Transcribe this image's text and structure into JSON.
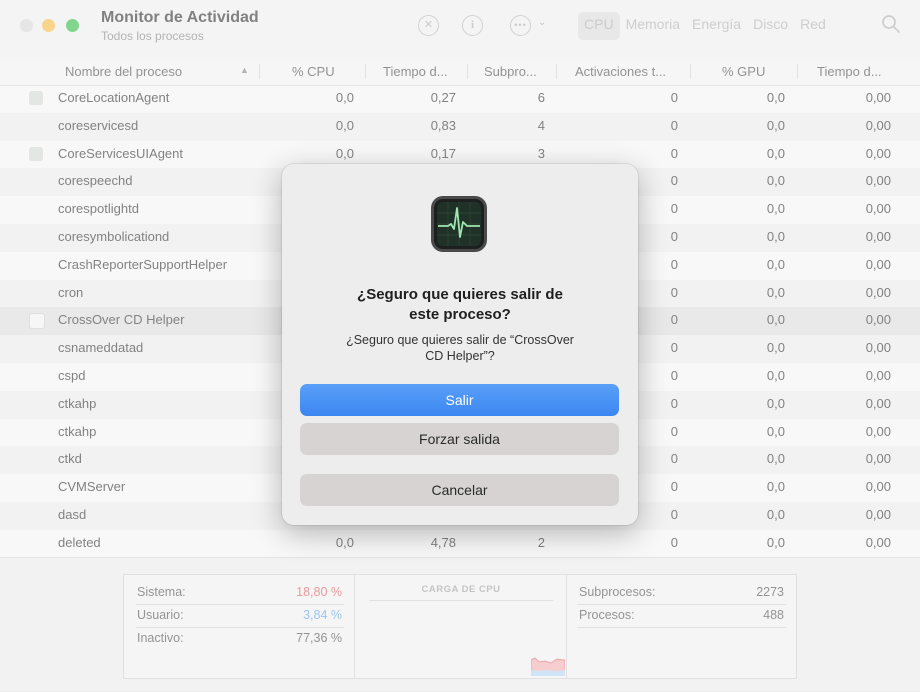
{
  "window": {
    "title": "Monitor de Actividad",
    "subtitle": "Todos los procesos"
  },
  "toolbar": {
    "stop_icon": "stop-process-icon",
    "info_icon": "info-icon",
    "more_icon": "more-options-icon",
    "tabs": [
      "CPU",
      "Memoria",
      "Energía",
      "Disco",
      "Red"
    ],
    "active_tab": "CPU",
    "search_icon": "search-icon"
  },
  "table": {
    "columns": [
      "Nombre del proceso",
      "% CPU",
      "Tiempo d...",
      "Subpro...",
      "Activaciones t...",
      "% GPU",
      "Tiempo d..."
    ],
    "rows": [
      {
        "name": "CoreLocationAgent",
        "cpu": "0,0",
        "time": "0,27",
        "threads": "6",
        "wakeups": "0",
        "gpu": "0,0",
        "gpu_time": "0,00",
        "icon": "app"
      },
      {
        "name": "coreservicesd",
        "cpu": "0,0",
        "time": "0,83",
        "threads": "4",
        "wakeups": "0",
        "gpu": "0,0",
        "gpu_time": "0,00",
        "icon": ""
      },
      {
        "name": "CoreServicesUIAgent",
        "cpu": "0,0",
        "time": "0,17",
        "threads": "3",
        "wakeups": "0",
        "gpu": "0,0",
        "gpu_time": "0,00",
        "icon": "app"
      },
      {
        "name": "corespeechd",
        "cpu": "",
        "time": "",
        "threads": "",
        "wakeups": "0",
        "gpu": "0,0",
        "gpu_time": "0,00",
        "icon": ""
      },
      {
        "name": "corespotlightd",
        "cpu": "",
        "time": "",
        "threads": "",
        "wakeups": "0",
        "gpu": "0,0",
        "gpu_time": "0,00",
        "icon": ""
      },
      {
        "name": "coresymbolicationd",
        "cpu": "",
        "time": "",
        "threads": "",
        "wakeups": "0",
        "gpu": "0,0",
        "gpu_time": "0,00",
        "icon": ""
      },
      {
        "name": "CrashReporterSupportHelper",
        "cpu": "",
        "time": "",
        "threads": "",
        "wakeups": "0",
        "gpu": "0,0",
        "gpu_time": "0,00",
        "icon": ""
      },
      {
        "name": "cron",
        "cpu": "",
        "time": "",
        "threads": "",
        "wakeups": "0",
        "gpu": "0,0",
        "gpu_time": "0,00",
        "icon": ""
      },
      {
        "name": "CrossOver CD Helper",
        "cpu": "",
        "time": "",
        "threads": "",
        "wakeups": "0",
        "gpu": "0,0",
        "gpu_time": "0,00",
        "icon": "blank",
        "selected": true
      },
      {
        "name": "csnameddatad",
        "cpu": "",
        "time": "",
        "threads": "",
        "wakeups": "0",
        "gpu": "0,0",
        "gpu_time": "0,00",
        "icon": ""
      },
      {
        "name": "cspd",
        "cpu": "",
        "time": "",
        "threads": "",
        "wakeups": "0",
        "gpu": "0,0",
        "gpu_time": "0,00",
        "icon": ""
      },
      {
        "name": "ctkahp",
        "cpu": "",
        "time": "",
        "threads": "",
        "wakeups": "0",
        "gpu": "0,0",
        "gpu_time": "0,00",
        "icon": ""
      },
      {
        "name": "ctkahp",
        "cpu": "",
        "time": "",
        "threads": "",
        "wakeups": "0",
        "gpu": "0,0",
        "gpu_time": "0,00",
        "icon": ""
      },
      {
        "name": "ctkd",
        "cpu": "",
        "time": "",
        "threads": "",
        "wakeups": "0",
        "gpu": "0,0",
        "gpu_time": "0,00",
        "icon": ""
      },
      {
        "name": "CVMServer",
        "cpu": "",
        "time": "",
        "threads": "",
        "wakeups": "0",
        "gpu": "0,0",
        "gpu_time": "0,00",
        "icon": ""
      },
      {
        "name": "dasd",
        "cpu": "",
        "time": "",
        "threads": "",
        "wakeups": "0",
        "gpu": "0,0",
        "gpu_time": "0,00",
        "icon": ""
      },
      {
        "name": "deleted",
        "cpu": "0,0",
        "time": "4,78",
        "threads": "2",
        "wakeups": "0",
        "gpu": "0,0",
        "gpu_time": "0,00",
        "icon": ""
      }
    ]
  },
  "footer": {
    "system_label": "Sistema:",
    "system_value": "18,80 %",
    "user_label": "Usuario:",
    "user_value": "3,84 %",
    "idle_label": "Inactivo:",
    "idle_value": "77,36 %",
    "cpu_load_title": "CARGA DE CPU",
    "threads_label": "Subprocesos:",
    "threads_value": "2273",
    "processes_label": "Procesos:",
    "processes_value": "488",
    "system_color": "#e0656a",
    "user_color": "#6aa7e6"
  },
  "dialog": {
    "icon": "activity-monitor-app-icon",
    "title_line1": "¿Seguro que quieres salir de",
    "title_line2": "este proceso?",
    "message_line1": "¿Seguro que quieres salir de “CrossOver",
    "message_line2": "CD Helper”?",
    "quit_label": "Salir",
    "force_quit_label": "Forzar salida",
    "cancel_label": "Cancelar",
    "primary_color": "#3b86f1"
  }
}
